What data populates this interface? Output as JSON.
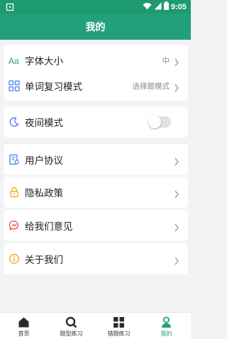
{
  "status_bar": {
    "time": "9:05"
  },
  "app_bar": {
    "title": "我的"
  },
  "settings": {
    "font_size": {
      "label": "字体大小",
      "value": "中"
    },
    "review_mode": {
      "label": "单词复习模式",
      "value": "选择题模式"
    },
    "night_mode": {
      "label": "夜间模式",
      "enabled": false
    }
  },
  "links": {
    "user_agreement": "用户协议",
    "privacy_policy": "隐私政策",
    "feedback": "给我们意见",
    "about_us": "关于我们"
  },
  "bottom_nav": {
    "items": [
      {
        "label": "首页"
      },
      {
        "label": "题型练习"
      },
      {
        "label": "错题练习"
      },
      {
        "label": "我的"
      }
    ],
    "active_index": 3
  },
  "colors": {
    "brand": "#22a07a",
    "statusbar": "#1e9a73",
    "accent_blue": "#3b82f6",
    "accent_orange": "#f59e0b",
    "accent_red": "#ef4444"
  }
}
